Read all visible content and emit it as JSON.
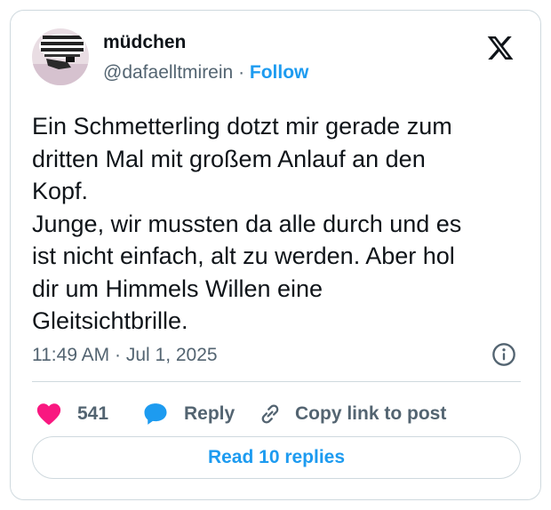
{
  "author": {
    "display_name": "müdchen",
    "handle": "@dafaelltmirein",
    "separator": "·",
    "follow_label": "Follow",
    "avatar_icon": "profile-photo"
  },
  "tweet": {
    "lines": [
      "Ein Schmetterling dotzt mir gerade zum",
      "dritten Mal mit großem Anlauf an den",
      "Kopf.",
      "Junge, wir mussten da alle durch und es",
      "ist nicht einfach, alt zu werden. Aber hol",
      "dir um Himmels Willen eine",
      "Gleitsichtbrille."
    ],
    "timestamp": "11:49 AM · Jul 1, 2025"
  },
  "actions": {
    "like_count": "541",
    "reply_label": "Reply",
    "copy_label": "Copy link to post"
  },
  "read_replies_label": "Read 10 replies",
  "colors": {
    "accent": "#1d9bf0",
    "like": "#f91880",
    "text": "#0f1419",
    "muted": "#536471",
    "border": "#cfd9de"
  },
  "icons": [
    "x-logo-icon",
    "info-icon",
    "heart-icon",
    "reply-bubble-icon",
    "link-icon"
  ]
}
